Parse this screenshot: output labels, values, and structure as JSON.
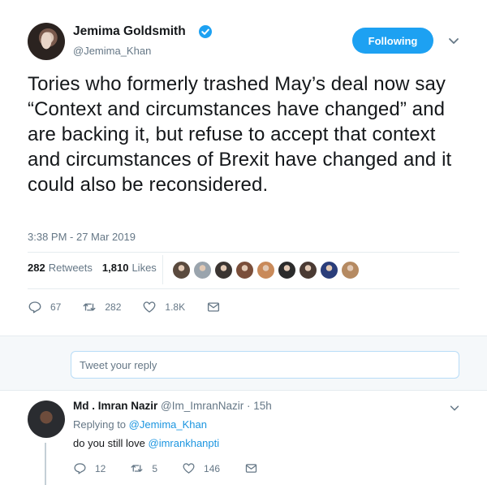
{
  "tweet": {
    "author_name": "Jemima Goldsmith",
    "author_handle": "@Jemima_Khan",
    "follow_label": "Following",
    "text": "Tories who formerly trashed May’s deal now say “Context and circumstances have changed” and are backing it, but refuse to accept that context and circumstances of Brexit have changed and it could also be reconsidered.",
    "timestamp": "3:38 PM - 27 Mar 2019",
    "retweets_count": "282",
    "retweets_label": "Retweets",
    "likes_count": "1,810",
    "likes_label": "Likes",
    "actions": {
      "reply_count": "67",
      "retweet_count": "282",
      "like_count": "1.8K"
    }
  },
  "likers": [
    "#5a4a3e",
    "#9aa4ad",
    "#3b3532",
    "#7a4e3a",
    "#c98a5a",
    "#2b2b2b",
    "#4a3a33",
    "#2a3d7a",
    "#b58a62"
  ],
  "reply_box": {
    "placeholder": "Tweet your reply"
  },
  "reply": {
    "author_name": "Md . Imran Nazir",
    "author_handle": "@Im_ImranNazir",
    "time": "· 15h",
    "replying_prefix": "Replying to",
    "replying_to": "@Jemima_Khan",
    "text_prefix": "do you still love",
    "mention": "@imrankhanpti",
    "actions": {
      "reply_count": "12",
      "retweet_count": "5",
      "like_count": "146"
    }
  },
  "colors": {
    "brand": "#1da1f2",
    "link": "#1b95e0",
    "muted": "#657786"
  }
}
